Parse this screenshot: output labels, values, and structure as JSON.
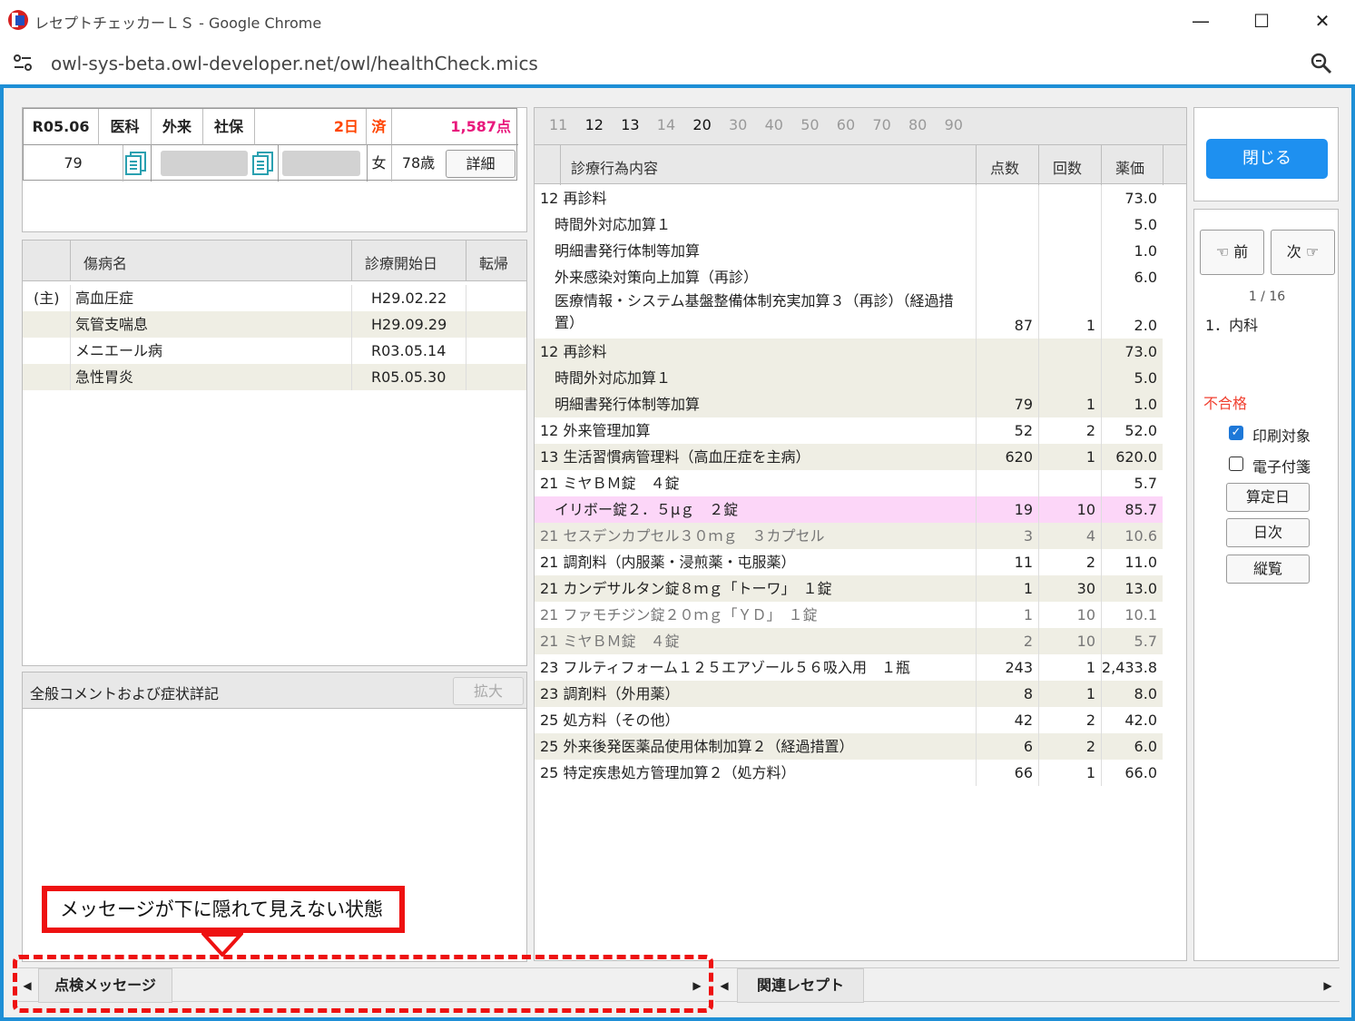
{
  "window": {
    "title": "レセプトチェッカーＬＳ - Google Chrome",
    "minimize": "—",
    "maximize": "☐",
    "close": "✕",
    "url": "owl-sys-beta.owl-developer.net/owl/healthCheck.mics"
  },
  "header": {
    "date": "R05.06",
    "dept": "医科",
    "visit": "外来",
    "insurance": "社保",
    "days": "2日",
    "done": "済",
    "points": "1,587点",
    "patient_no": "79",
    "sex": "女",
    "age": "78歳",
    "detail_button": "詳細"
  },
  "disease": {
    "columns": [
      "傷病名",
      "診療開始日",
      "転帰"
    ],
    "rows": [
      {
        "flag": "(主)",
        "name": "高血圧症",
        "date": "H29.02.22",
        "outcome": ""
      },
      {
        "flag": "",
        "name": "気管支喘息",
        "date": "H29.09.29",
        "outcome": ""
      },
      {
        "flag": "",
        "name": "メニエール病",
        "date": "R03.05.14",
        "outcome": ""
      },
      {
        "flag": "",
        "name": "急性胃炎",
        "date": "R05.05.30",
        "outcome": ""
      }
    ]
  },
  "comment": {
    "title": "全般コメントおよび症状詳記",
    "expand_button": "拡大"
  },
  "category_tabs": [
    "11",
    "12",
    "13",
    "14",
    "20",
    "30",
    "40",
    "50",
    "60",
    "70",
    "80",
    "90"
  ],
  "category_active": [
    "12",
    "13",
    "20"
  ],
  "treatment": {
    "columns": [
      "診療行為内容",
      "点数",
      "回数",
      "薬価"
    ],
    "rows": [
      {
        "text": "12 再診料",
        "pts": "",
        "cnt": "",
        "price": "73.0",
        "style": ""
      },
      {
        "text": "　時間外対応加算１",
        "pts": "",
        "cnt": "",
        "price": "5.0",
        "style": ""
      },
      {
        "text": "　明細書発行体制等加算",
        "pts": "",
        "cnt": "",
        "price": "1.0",
        "style": ""
      },
      {
        "text": "　外来感染対策向上加算（再診）",
        "pts": "",
        "cnt": "",
        "price": "6.0",
        "style": ""
      },
      {
        "text": "　医療情報・システム基盤整備体制充実加算３（再診）（経過措",
        "text2": "　置）",
        "pts": "87",
        "cnt": "1",
        "price": "2.0",
        "style": "tall"
      },
      {
        "text": "12 再診料",
        "pts": "",
        "cnt": "",
        "price": "73.0",
        "style": "alt"
      },
      {
        "text": "　時間外対応加算１",
        "pts": "",
        "cnt": "",
        "price": "5.0",
        "style": "alt"
      },
      {
        "text": "　明細書発行体制等加算",
        "pts": "79",
        "cnt": "1",
        "price": "1.0",
        "style": "alt"
      },
      {
        "text": "12 外来管理加算",
        "pts": "52",
        "cnt": "2",
        "price": "52.0",
        "style": ""
      },
      {
        "text": "13 生活習慣病管理料（高血圧症を主病）",
        "pts": "620",
        "cnt": "1",
        "price": "620.0",
        "style": "alt"
      },
      {
        "text": "21 ミヤＢＭ錠　４錠",
        "pts": "",
        "cnt": "",
        "price": "5.7",
        "style": ""
      },
      {
        "text": "　イリボー錠２．５μｇ　２錠",
        "pts": "19",
        "cnt": "10",
        "price": "85.7",
        "style": "pink"
      },
      {
        "text": "21 セスデンカプセル３０ｍｇ　３カプセル",
        "pts": "3",
        "cnt": "4",
        "price": "10.6",
        "style": "alt dim"
      },
      {
        "text": "21 調剤料（内服薬・浸煎薬・屯服薬）",
        "pts": "11",
        "cnt": "2",
        "price": "11.0",
        "style": ""
      },
      {
        "text": "21 カンデサルタン錠８ｍｇ「トーワ」　１錠",
        "pts": "1",
        "cnt": "30",
        "price": "13.0",
        "style": "alt"
      },
      {
        "text": "21 ファモチジン錠２０ｍｇ「ＹＤ」　１錠",
        "pts": "1",
        "cnt": "10",
        "price": "10.1",
        "style": "dim"
      },
      {
        "text": "21 ミヤＢＭ錠　４錠",
        "pts": "2",
        "cnt": "10",
        "price": "5.7",
        "style": "alt dim"
      },
      {
        "text": "23 フルティフォーム１２５エアゾール５６吸入用　１瓶",
        "pts": "243",
        "cnt": "1",
        "price": "2,433.8",
        "style": ""
      },
      {
        "text": "23 調剤料（外用薬）",
        "pts": "8",
        "cnt": "1",
        "price": "8.0",
        "style": "alt"
      },
      {
        "text": "25 処方料（その他）",
        "pts": "42",
        "cnt": "2",
        "price": "42.0",
        "style": ""
      },
      {
        "text": "25 外来後発医薬品使用体制加算２（経過措置）",
        "pts": "6",
        "cnt": "2",
        "price": "6.0",
        "style": "alt"
      },
      {
        "text": "25 特定疾患処方管理加算２（処方料）",
        "pts": "66",
        "cnt": "1",
        "price": "66.0",
        "style": ""
      }
    ]
  },
  "right": {
    "close_button": "閉じる",
    "prev_button": "前",
    "next_button": "次",
    "page_indicator": "1 / 16",
    "dept_item": "1．内科",
    "status": "不合格",
    "print_target": "印刷対象",
    "print_checked": true,
    "e_sticky": "電子付箋",
    "e_checked": false,
    "btn_date": "算定日",
    "btn_daily": "日次",
    "btn_view": "縦覧"
  },
  "bottom_tabs": {
    "left": "点検メッセージ",
    "right": "関連レセプト"
  },
  "annotation": {
    "callout_text": "メッセージが下に隠れて見えない状態"
  },
  "colors": {
    "accent": "#1e8fd6",
    "close_btn": "#1e90f0",
    "pink": "#e8187c",
    "orange": "#ff4400",
    "fail_red": "#f04030",
    "annotation_red": "#ee1111"
  }
}
